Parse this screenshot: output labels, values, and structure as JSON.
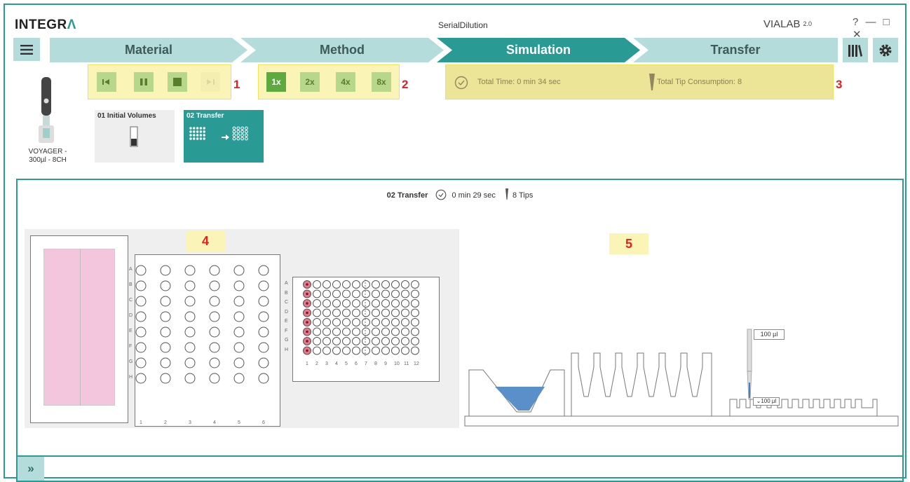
{
  "app": {
    "logo_left": "INTEGR",
    "logo_accent": "Λ",
    "window_title": "SerialDilution",
    "brand": "VIALAB",
    "version": "2.0",
    "window_controls": "? — □ ✕"
  },
  "steps": [
    "Material",
    "Method",
    "Simulation",
    "Transfer"
  ],
  "controls": {
    "playback": [
      "step-back-icon",
      "pause-icon",
      "stop-icon",
      "step-forward-icon"
    ],
    "playback_marker": "1",
    "speeds": [
      "1x",
      "2x",
      "4x",
      "8x"
    ],
    "speed_marker": "2",
    "total_time": "Total Time: 0 min 34 sec",
    "total_tips": "Total Tip Consumption: 8",
    "info_marker": "3"
  },
  "pipette": {
    "label": "VOYAGER -\n300µl - 8CH"
  },
  "program_steps": [
    {
      "label": "01 Initial Volumes"
    },
    {
      "label": "02 Transfer"
    }
  ],
  "detail": {
    "step_name": "02 Transfer",
    "time": "0 min 29 sec",
    "tips": "8 Tips",
    "deck_marker": "4",
    "side_marker": "5",
    "rows": [
      "A",
      "B",
      "C",
      "D",
      "E",
      "F",
      "G",
      "H"
    ],
    "cols6": [
      "1",
      "2",
      "3",
      "4",
      "5",
      "6"
    ],
    "cols12": [
      "1",
      "2",
      "3",
      "4",
      "5",
      "6",
      "7",
      "8",
      "9",
      "10",
      "11",
      "12"
    ],
    "volume_label": "100 µl",
    "volume_label2": "100 µl"
  },
  "footer": {
    "expand": "»"
  },
  "colors": {
    "teal": "#2a9a95",
    "teal_light": "#b3dcdb",
    "highlight": "#faf5b6",
    "marker": "#e22020",
    "reservoir": "#f4c6dd",
    "liquid": "#5b8fc9"
  }
}
